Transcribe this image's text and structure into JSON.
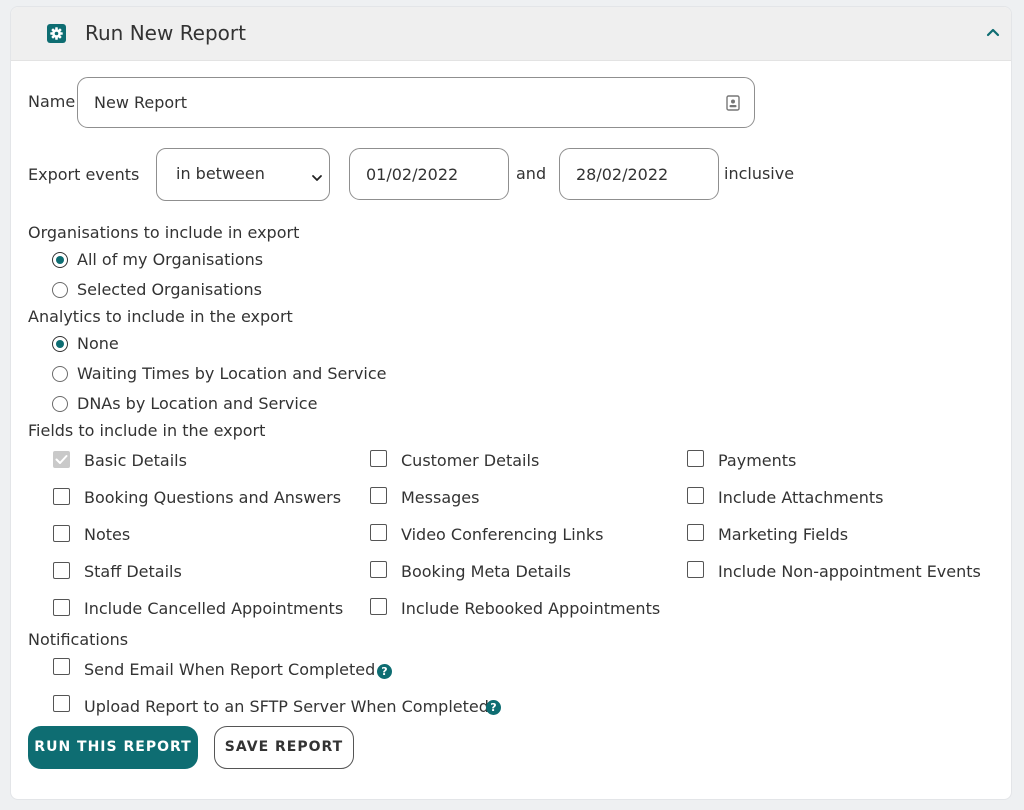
{
  "header": {
    "title": "Run New Report",
    "icon": "gear-icon",
    "collapse_icon": "chevron-up-icon",
    "accent": "#0e6d72"
  },
  "name": {
    "label": "Name",
    "value": "New Report",
    "icon": "contact-card-icon"
  },
  "export_events": {
    "label": "Export events",
    "selected": "in between",
    "from": "01/02/2022",
    "and_label": "and",
    "to": "28/02/2022",
    "suffix": "inclusive"
  },
  "organisations": {
    "title": "Organisations to include in export",
    "options": [
      {
        "label": "All of my Organisations",
        "checked": true
      },
      {
        "label": "Selected Organisations",
        "checked": false
      }
    ]
  },
  "analytics": {
    "title": "Analytics to include in the export",
    "options": [
      {
        "label": "None",
        "checked": true
      },
      {
        "label": "Waiting Times by Location and Service",
        "checked": false
      },
      {
        "label": "DNAs by Location and Service",
        "checked": false
      }
    ]
  },
  "fields": {
    "title": "Fields to include in the export",
    "col1": [
      {
        "label": "Basic Details",
        "checked": true,
        "disabled": true
      },
      {
        "label": "Booking Questions and Answers",
        "checked": false
      },
      {
        "label": "Notes",
        "checked": false
      },
      {
        "label": "Staff Details",
        "checked": false
      },
      {
        "label": "Include Cancelled Appointments",
        "checked": false
      }
    ],
    "col2": [
      {
        "label": "Customer Details",
        "checked": false
      },
      {
        "label": "Messages",
        "checked": false
      },
      {
        "label": "Video Conferencing Links",
        "checked": false
      },
      {
        "label": "Booking Meta Details",
        "checked": false
      },
      {
        "label": "Include Rebooked Appointments",
        "checked": false
      }
    ],
    "col3": [
      {
        "label": "Payments",
        "checked": false
      },
      {
        "label": "Include Attachments",
        "checked": false
      },
      {
        "label": "Marketing Fields",
        "checked": false
      },
      {
        "label": "Include Non-appointment Events",
        "checked": false
      }
    ]
  },
  "notifications": {
    "title": "Notifications",
    "options": [
      {
        "label": "Send Email When Report Completed",
        "checked": false,
        "help_icon": "question-icon"
      },
      {
        "label": "Upload Report to an SFTP Server When Completed",
        "checked": false,
        "help_icon": "question-icon"
      }
    ],
    "help_glyph": "?"
  },
  "buttons": {
    "run": "RUN THIS REPORT",
    "save": "SAVE REPORT"
  }
}
